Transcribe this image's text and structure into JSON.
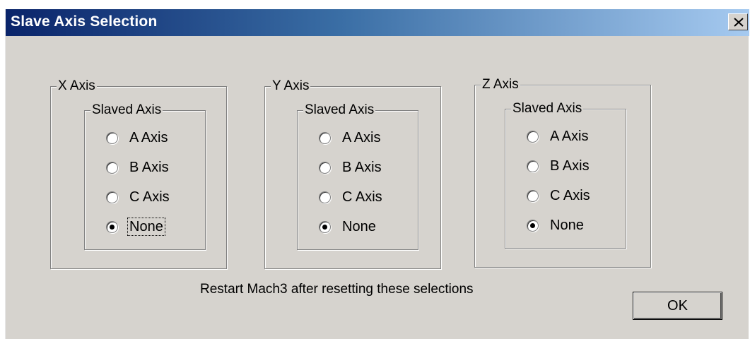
{
  "window": {
    "title": "Slave Axis Selection",
    "close_label": "×"
  },
  "groups": [
    {
      "title": "X Axis",
      "subgroup_title": "Slaved Axis",
      "options": [
        "A Axis",
        "B Axis",
        "C Axis",
        "None"
      ],
      "selected": "None"
    },
    {
      "title": "Y Axis",
      "subgroup_title": "Slaved Axis",
      "options": [
        "A Axis",
        "B Axis",
        "C Axis",
        "None"
      ],
      "selected": "None"
    },
    {
      "title": "Z Axis",
      "subgroup_title": "Slaved Axis",
      "options": [
        "A Axis",
        "B Axis",
        "C Axis",
        "None"
      ],
      "selected": "None"
    }
  ],
  "notice": "Restart Mach3 after resetting these selections",
  "ok_label": "OK",
  "colors": {
    "title_gradient_start": "#0a246a",
    "title_gradient_end": "#a6caf0",
    "dialog_face": "#d6d3ce"
  }
}
